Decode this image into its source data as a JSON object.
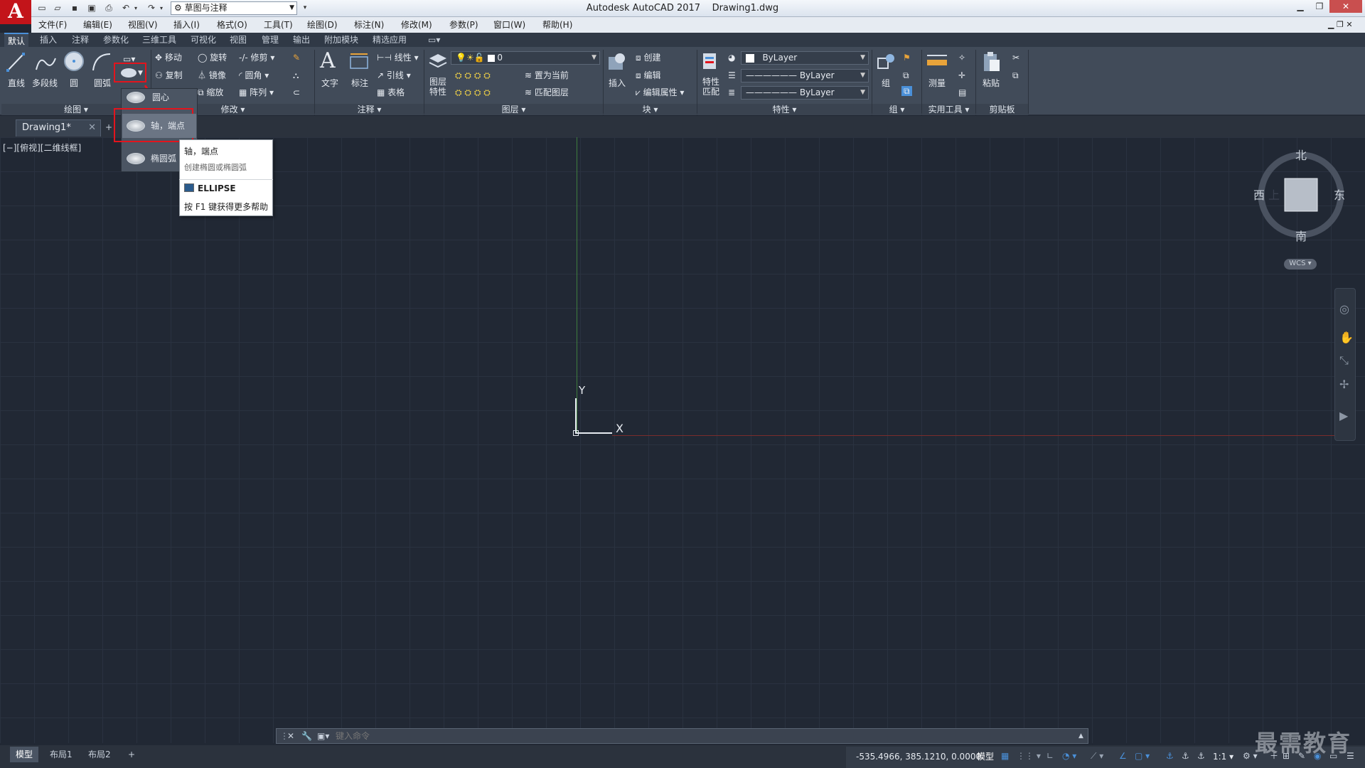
{
  "title_bar": {
    "app": "Autodesk AutoCAD 2017",
    "file": "Drawing1.dwg",
    "logo": "A",
    "workspace": "草图与注释"
  },
  "menus": [
    "文件(F)",
    "编辑(E)",
    "视图(V)",
    "插入(I)",
    "格式(O)",
    "工具(T)",
    "绘图(D)",
    "标注(N)",
    "修改(M)",
    "参数(P)",
    "窗口(W)",
    "帮助(H)"
  ],
  "ribbon_tabs": [
    "默认",
    "插入",
    "注释",
    "参数化",
    "三维工具",
    "可视化",
    "视图",
    "管理",
    "输出",
    "附加模块",
    "精选应用"
  ],
  "draw_panel": {
    "line": "直线",
    "polyline": "多段线",
    "circle": "圆",
    "arc": "圆弧",
    "footer": "绘图"
  },
  "modify_panel": {
    "move": "移动",
    "rotate": "旋转",
    "trim": "修剪",
    "copy": "复制",
    "mirror": "镜像",
    "fillet": "圆角",
    "scale": "缩放",
    "array": "阵列",
    "footer": "修改"
  },
  "annotation_panel": {
    "text": "文字",
    "dimension": "标注",
    "linear": "线性",
    "leader": "引线",
    "table": "表格",
    "footer": "注释"
  },
  "layers_panel": {
    "layer_props": "图层\n特性",
    "current_layer": "0",
    "set_current": "置为当前",
    "match_layer": "匹配图层",
    "footer": "图层"
  },
  "block_panel": {
    "insert": "插入",
    "create": "创建",
    "edit": "编辑",
    "edit_attr": "编辑属性",
    "footer": "块"
  },
  "properties_panel": {
    "match": "特性\n匹配",
    "color": "ByLayer",
    "linetype": "ByLayer",
    "lineweight": "ByLayer",
    "footer": "特性"
  },
  "groups_panel": {
    "group": "组",
    "footer": "组"
  },
  "utilities_panel": {
    "measure": "测量",
    "footer": "实用工具"
  },
  "clipboard_panel": {
    "paste": "粘贴",
    "footer": "剪贴板"
  },
  "doc_tab": "Drawing1*",
  "viewport_label": "[−][俯视][二维线框]",
  "ellipse_menu": [
    "圆心",
    "轴，端点",
    "椭圆弧"
  ],
  "tooltip": {
    "title": "轴，端点",
    "desc": "创建椭圆或椭圆弧",
    "command": "ELLIPSE",
    "help": "按 F1 键获得更多帮助"
  },
  "ucs": {
    "x": "X",
    "y": "Y"
  },
  "viewcube": {
    "north": "北",
    "south": "南",
    "east": "东",
    "west": "西",
    "top": "上",
    "wcs": "WCS"
  },
  "command_line": {
    "placeholder": "键入命令"
  },
  "layout_tabs": [
    "模型",
    "布局1",
    "布局2"
  ],
  "status": {
    "coords": "-535.4966, 385.1210, 0.0000",
    "model": "模型",
    "scale": "1:1"
  },
  "watermark": "最需教育"
}
